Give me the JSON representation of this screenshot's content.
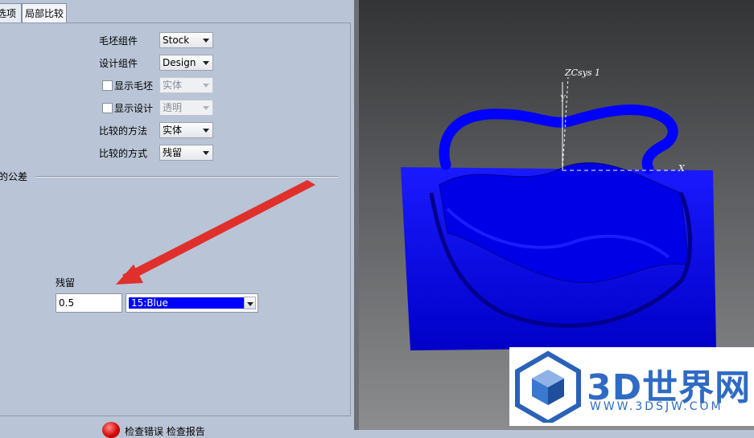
{
  "tabs": [
    {
      "label": "选项",
      "active": false
    },
    {
      "label": "局部比较",
      "active": true
    }
  ],
  "form": {
    "stock_component": {
      "label": "毛坯组件",
      "value": "Stock"
    },
    "design_component": {
      "label": "设计组件",
      "value": "Design"
    },
    "show_stock": {
      "label": "显示毛坯",
      "checked": false,
      "value": "实体"
    },
    "show_design": {
      "label": "显示设计",
      "checked": false,
      "value": "透明"
    },
    "compare_method": {
      "label": "比较的方法",
      "value": "实体"
    },
    "compare_mode": {
      "label": "比较的方式",
      "value": "残留"
    }
  },
  "tolerance_group": {
    "label": "的公差"
  },
  "residual": {
    "label": "残留",
    "value": "0.5",
    "color": "15:Blue",
    "color_hex": "#0000ff"
  },
  "bottom": {
    "text": "检查错误   检查报告"
  },
  "viewport": {
    "csys_label": "ZCsys 1",
    "x_axis": "X",
    "y_axis": "Y",
    "model_color": "#0000ff"
  },
  "watermark": {
    "title": "3D世界网",
    "url": "WWW.3DSJW.COM"
  }
}
